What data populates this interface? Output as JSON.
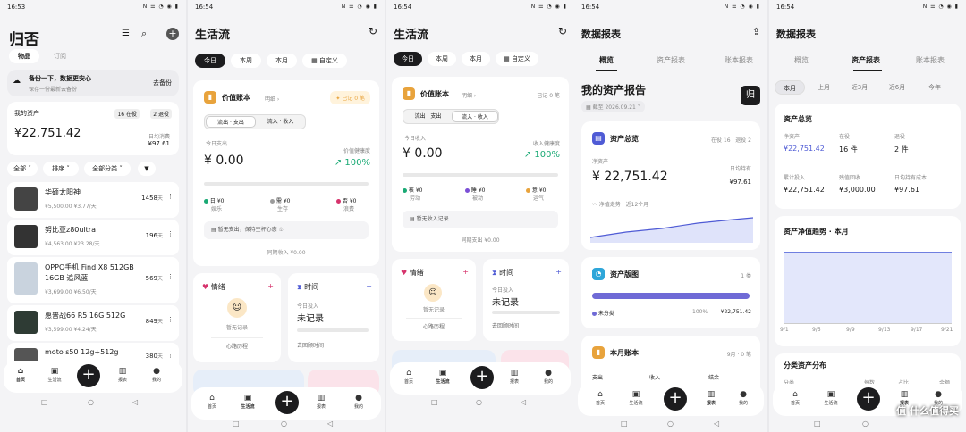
{
  "p1": {
    "time": "16:53",
    "status": "N ☰ ◔ ◉ ▮",
    "title": "归否",
    "tab_items": "物品",
    "tab_sub": "订阅",
    "backup_title": "备份一下，数据更安心",
    "backup_sub": "保存一份最新云备份",
    "backup_link": "去备份",
    "assets_label": "我的资产",
    "assets_in": "16 在役",
    "assets_ret": "2 退役",
    "assets_value": "¥22,751.42",
    "daily_label": "日均消费",
    "daily_value": "¥97.61",
    "filter_all": "全部",
    "filter_sort": "排序",
    "filter_cat": "全部分类",
    "items": [
      {
        "name": "华硕太阳神",
        "price": "¥5,500.00",
        "daily": "¥3.77/天",
        "days": "1458",
        "unit": "天"
      },
      {
        "name": "努比亚z80ultra",
        "price": "¥4,563.00",
        "daily": "¥23.28/天",
        "days": "196",
        "unit": "天"
      },
      {
        "name": "OPPO手机 Find X8 512GB",
        "name2": "16GB 追风蓝",
        "price": "¥3,699.00",
        "daily": "¥6.50/天",
        "days": "569",
        "unit": "天"
      },
      {
        "name": "惠普战66 R5 16G 512G",
        "price": "¥3,599.00",
        "daily": "¥4.24/天",
        "days": "849",
        "unit": "天"
      },
      {
        "name": "moto s50 12g+512g",
        "price": "",
        "daily": "",
        "days": "380",
        "unit": "天"
      }
    ],
    "nav": [
      "首页",
      "生活流",
      "",
      "报表",
      "我的"
    ]
  },
  "p2": {
    "time": "16:54",
    "status": "N ☰ ◔ ◉ ▮",
    "title": "生活流",
    "periods": [
      "今日",
      "本周",
      "本月",
      "自定义"
    ],
    "ledger": "价值账本",
    "ledger_hint": "明细 ›",
    "ledger_badge": "已记 0 笔",
    "seg_a": "流出 · 支出",
    "seg_b": "流入 · 收入",
    "today_label": "今日支出",
    "health_label": "价值健康度",
    "amount": "¥ 0.00",
    "health": "↗ 100%",
    "legend": [
      {
        "t": "日 ¥0",
        "s": "娱乐",
        "c": "#19a974"
      },
      {
        "t": "需 ¥0",
        "s": "生存",
        "c": "#9b9b9b"
      },
      {
        "t": "否 ¥0",
        "s": "浪费",
        "c": "#d6336c"
      }
    ],
    "empty": "暂无支出，保持空杯心态",
    "footer": "同期收入 ¥0.00",
    "mood": "情绪",
    "mood_empty": "暂无记录",
    "mood_link": "心路历程",
    "time_card": "时间",
    "time_today": "今日投入",
    "time_empty": "未记录",
    "time_link": "去回顾时间",
    "nav": [
      "首页",
      "生活流",
      "",
      "报表",
      "我的"
    ]
  },
  "p3": {
    "time": "16:54",
    "status": "N ☰ ◔ ◉ ▮",
    "title": "生活流",
    "periods": [
      "今日",
      "本周",
      "本月",
      "自定义"
    ],
    "ledger": "价值账本",
    "ledger_hint": "明细 ›",
    "ledger_badge": "已记 0 笔",
    "seg_a": "流出 · 支出",
    "seg_b": "流入 · 收入",
    "today_label": "今日收入",
    "health_label": "收入健康度",
    "amount": "¥ 0.00",
    "health": "↗ 100%",
    "legend": [
      {
        "t": "核 ¥0",
        "s": "劳动",
        "c": "#19a974"
      },
      {
        "t": "睡 ¥0",
        "s": "被动",
        "c": "#7b4fd6"
      },
      {
        "t": "意 ¥0",
        "s": "运气",
        "c": "#e8a33c"
      }
    ],
    "empty": "暂无收入记录",
    "footer": "同期支出 ¥0.00",
    "mood": "情绪",
    "mood_empty": "暂无记录",
    "mood_link": "心路历程",
    "time_card": "时间",
    "time_today": "今日投入",
    "time_empty": "未记录",
    "time_link": "去回顾时间",
    "nav": [
      "首页",
      "生活流",
      "",
      "报表",
      "我的"
    ]
  },
  "p4": {
    "time": "16:54",
    "status": "N ☰ ◔ ◉ ▮",
    "title": "数据报表",
    "tabs": [
      "概览",
      "资产报表",
      "账本报表"
    ],
    "report": "我的资产报告",
    "report_date": "截至 2026.09.21",
    "report_badge": "归",
    "total": "资产总览",
    "total_meta": "在役 16 · 退役 2",
    "net_label": "净资产",
    "net_value": "¥ 22,751.42",
    "daily_label": "日均持有",
    "daily_value": "¥97.61",
    "trend_label": "净值走势 · 近12个月",
    "map": "资产版图",
    "map_count": "1 类",
    "map_cat": "未分类",
    "map_pct": "100%",
    "map_val": "¥22,751.42",
    "month": "本月账本",
    "month_meta": "9月 · 0 笔",
    "cols": [
      "支出",
      "收入",
      "结余"
    ],
    "nav": [
      "首页",
      "生活流",
      "",
      "报表",
      "我的"
    ]
  },
  "p5": {
    "time": "16:54",
    "status": "N ☰ ◔ ◉ ▮",
    "title": "数据报表",
    "tabs": [
      "概览",
      "资产报表",
      "账本报表"
    ],
    "periods": [
      "本月",
      "上月",
      "近3月",
      "近6月",
      "今年"
    ],
    "total": "资产总览",
    "g1": [
      {
        "l": "净资产",
        "v": "¥22,751.42"
      },
      {
        "l": "在役",
        "v": "16 件"
      },
      {
        "l": "退役",
        "v": "2 件"
      }
    ],
    "g2": [
      {
        "l": "累计投入",
        "v": "¥22,751.42"
      },
      {
        "l": "残值回收",
        "v": "¥3,000.00"
      },
      {
        "l": "日均持有成本",
        "v": "¥97.61"
      }
    ],
    "trend": "资产净值趋势 · 本月",
    "xticks": [
      "9/1",
      "9/5",
      "9/9",
      "9/13",
      "9/17",
      "9/21"
    ],
    "dist": "分类资产分布",
    "dist_cols": [
      "分类",
      "每数",
      "占比",
      "金额"
    ],
    "nav": [
      "首页",
      "生活流",
      "",
      "报表",
      "我的"
    ],
    "watermark": "值 什么值得买"
  },
  "colors": {
    "accent": "#4f5bd5",
    "green": "#19a974",
    "orange": "#e8a33c"
  }
}
